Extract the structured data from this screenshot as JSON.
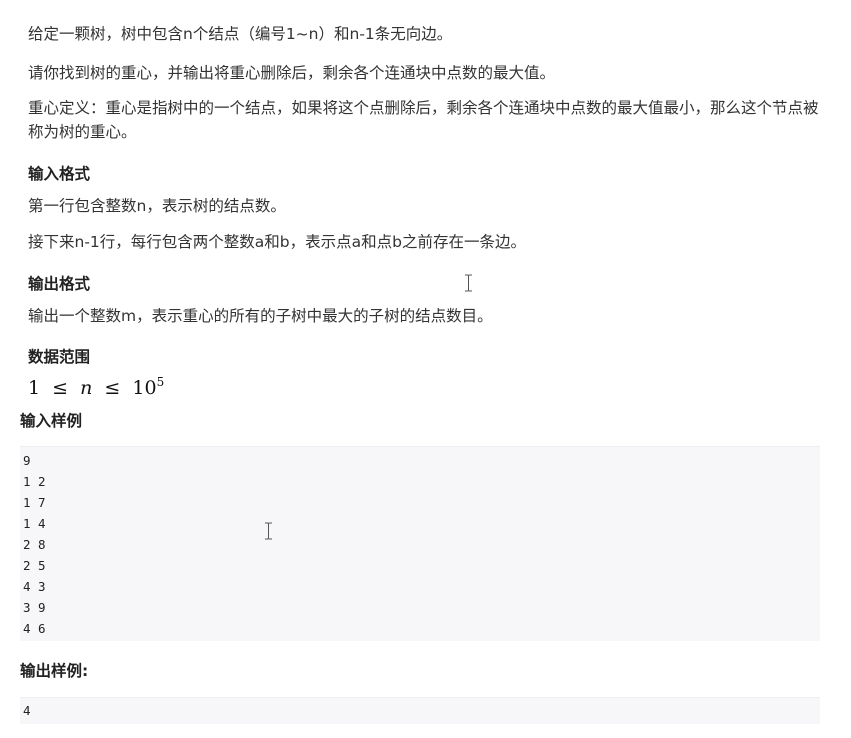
{
  "problem": {
    "description": [
      "给定一颗树，树中包含n个结点（编号1~n）和n-1条无向边。",
      "请你找到树的重心，并输出将重心删除后，剩余各个连通块中点数的最大值。",
      "重心定义：重心是指树中的一个结点，如果将这个点删除后，剩余各个连通块中点数的最大值最小，那么这个节点被称为树的重心。"
    ],
    "input_format": {
      "title": "输入格式",
      "lines": [
        "第一行包含整数n，表示树的结点数。",
        "接下来n-1行，每行包含两个整数a和b，表示点a和点b之前存在一条边。"
      ]
    },
    "output_format": {
      "title": "输出格式",
      "lines": [
        "输出一个整数m，表示重心的所有的子树中最大的子树的结点数目。"
      ]
    },
    "data_range": {
      "title": "数据范围",
      "formula": {
        "lower": "1",
        "op1": "≤",
        "var": "n",
        "op2": "≤",
        "base": "10",
        "exp": "5"
      }
    },
    "sample_input": {
      "title": "输入样例",
      "lines": [
        "9",
        "1 2",
        "1 7",
        "1 4",
        "2 8",
        "2 5",
        "4 3",
        "3 9",
        "4 6"
      ]
    },
    "sample_output": {
      "title": "输出样例:",
      "lines": [
        "4"
      ]
    }
  },
  "cursor_icon": "text-cursor-icon"
}
